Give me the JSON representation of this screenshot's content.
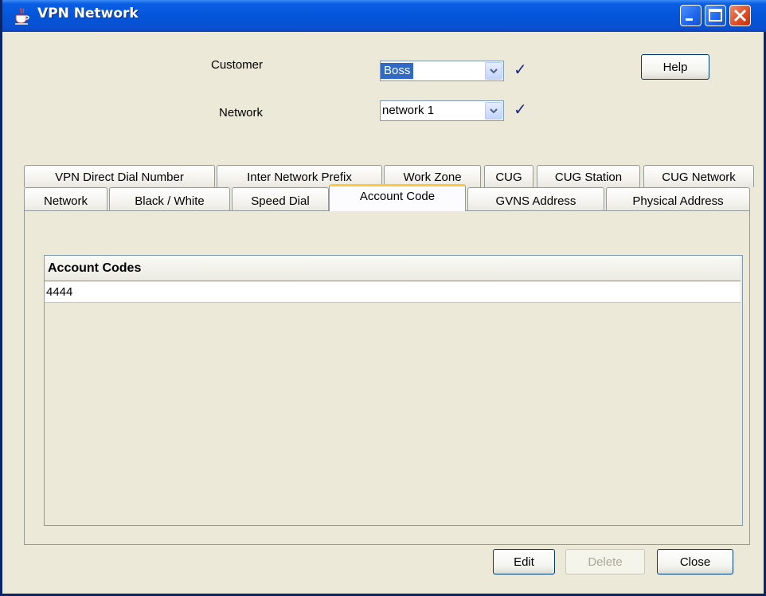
{
  "window": {
    "title": "VPN Network",
    "icon": "java-cup-icon",
    "controls": [
      "minimize",
      "maximize",
      "close"
    ]
  },
  "form": {
    "customer_label": "Customer",
    "customer_value": "Boss",
    "network_label": "Network",
    "network_value": "network 1",
    "help_label": "Help"
  },
  "tabs": {
    "row1": [
      "VPN Direct Dial Number",
      "Inter Network Prefix",
      "Work Zone",
      "CUG",
      "CUG Station",
      "CUG Network"
    ],
    "row2": [
      "Network",
      "Black / White",
      "Speed Dial",
      "Account Code",
      "GVNS Address",
      "Physical Address"
    ],
    "active": "Account Code"
  },
  "table": {
    "header": "Account Codes",
    "rows": [
      "4444"
    ]
  },
  "buttons": {
    "edit": "Edit",
    "delete": "Delete",
    "close": "Close"
  },
  "colors": {
    "titlebar": "#0454d8",
    "face": "#ece9d8",
    "selection": "#316ac5",
    "active_tab_accent": "#ffc83c"
  }
}
